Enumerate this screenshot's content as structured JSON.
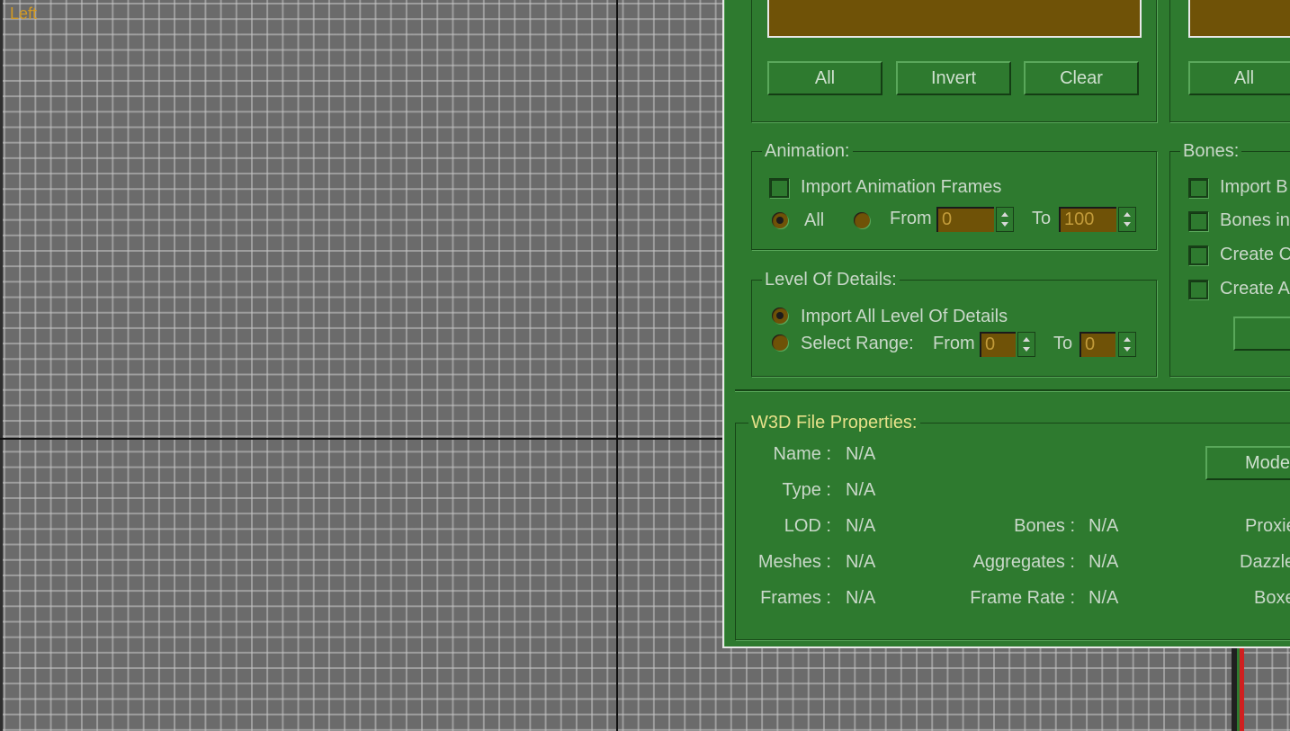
{
  "viewport": {
    "label": "Left"
  },
  "selection": {
    "all_label": "All",
    "invert_label": "Invert",
    "clear_label": "Clear",
    "right_all_label": "All"
  },
  "animation": {
    "title": "Animation:",
    "import_frames_label": "Import Animation Frames",
    "import_frames_checked": false,
    "all_label": "All",
    "all_selected": true,
    "from_label": "From",
    "from_value": "0",
    "to_label": "To",
    "to_value": "100"
  },
  "lod": {
    "title": "Level Of Details:",
    "import_all_label": "Import All Level Of Details",
    "import_all_selected": true,
    "select_range_label": "Select Range:",
    "from_label": "From",
    "from_value": "0",
    "to_label": "To",
    "to_value": "0"
  },
  "bones": {
    "title": "Bones:",
    "items": [
      {
        "label": "Import B",
        "checked": false
      },
      {
        "label": "Bones in",
        "checked": false
      },
      {
        "label": "Create C",
        "checked": false
      },
      {
        "label": "Create A",
        "checked": false
      }
    ]
  },
  "properties": {
    "title": "W3D File Properties:",
    "model_button": "Mode",
    "left": [
      {
        "label": "Name :",
        "value": "N/A"
      },
      {
        "label": "Type :",
        "value": "N/A"
      },
      {
        "label": "LOD :",
        "value": "N/A"
      },
      {
        "label": "Meshes :",
        "value": "N/A"
      },
      {
        "label": "Frames :",
        "value": "N/A"
      }
    ],
    "middle": [
      {
        "label": "Bones :",
        "value": "N/A"
      },
      {
        "label": "Aggregates :",
        "value": "N/A"
      },
      {
        "label": "Frame Rate :",
        "value": "N/A"
      }
    ],
    "right": [
      {
        "label": "Proxie"
      },
      {
        "label": "Dazzle"
      },
      {
        "label": "Boxe"
      }
    ]
  }
}
